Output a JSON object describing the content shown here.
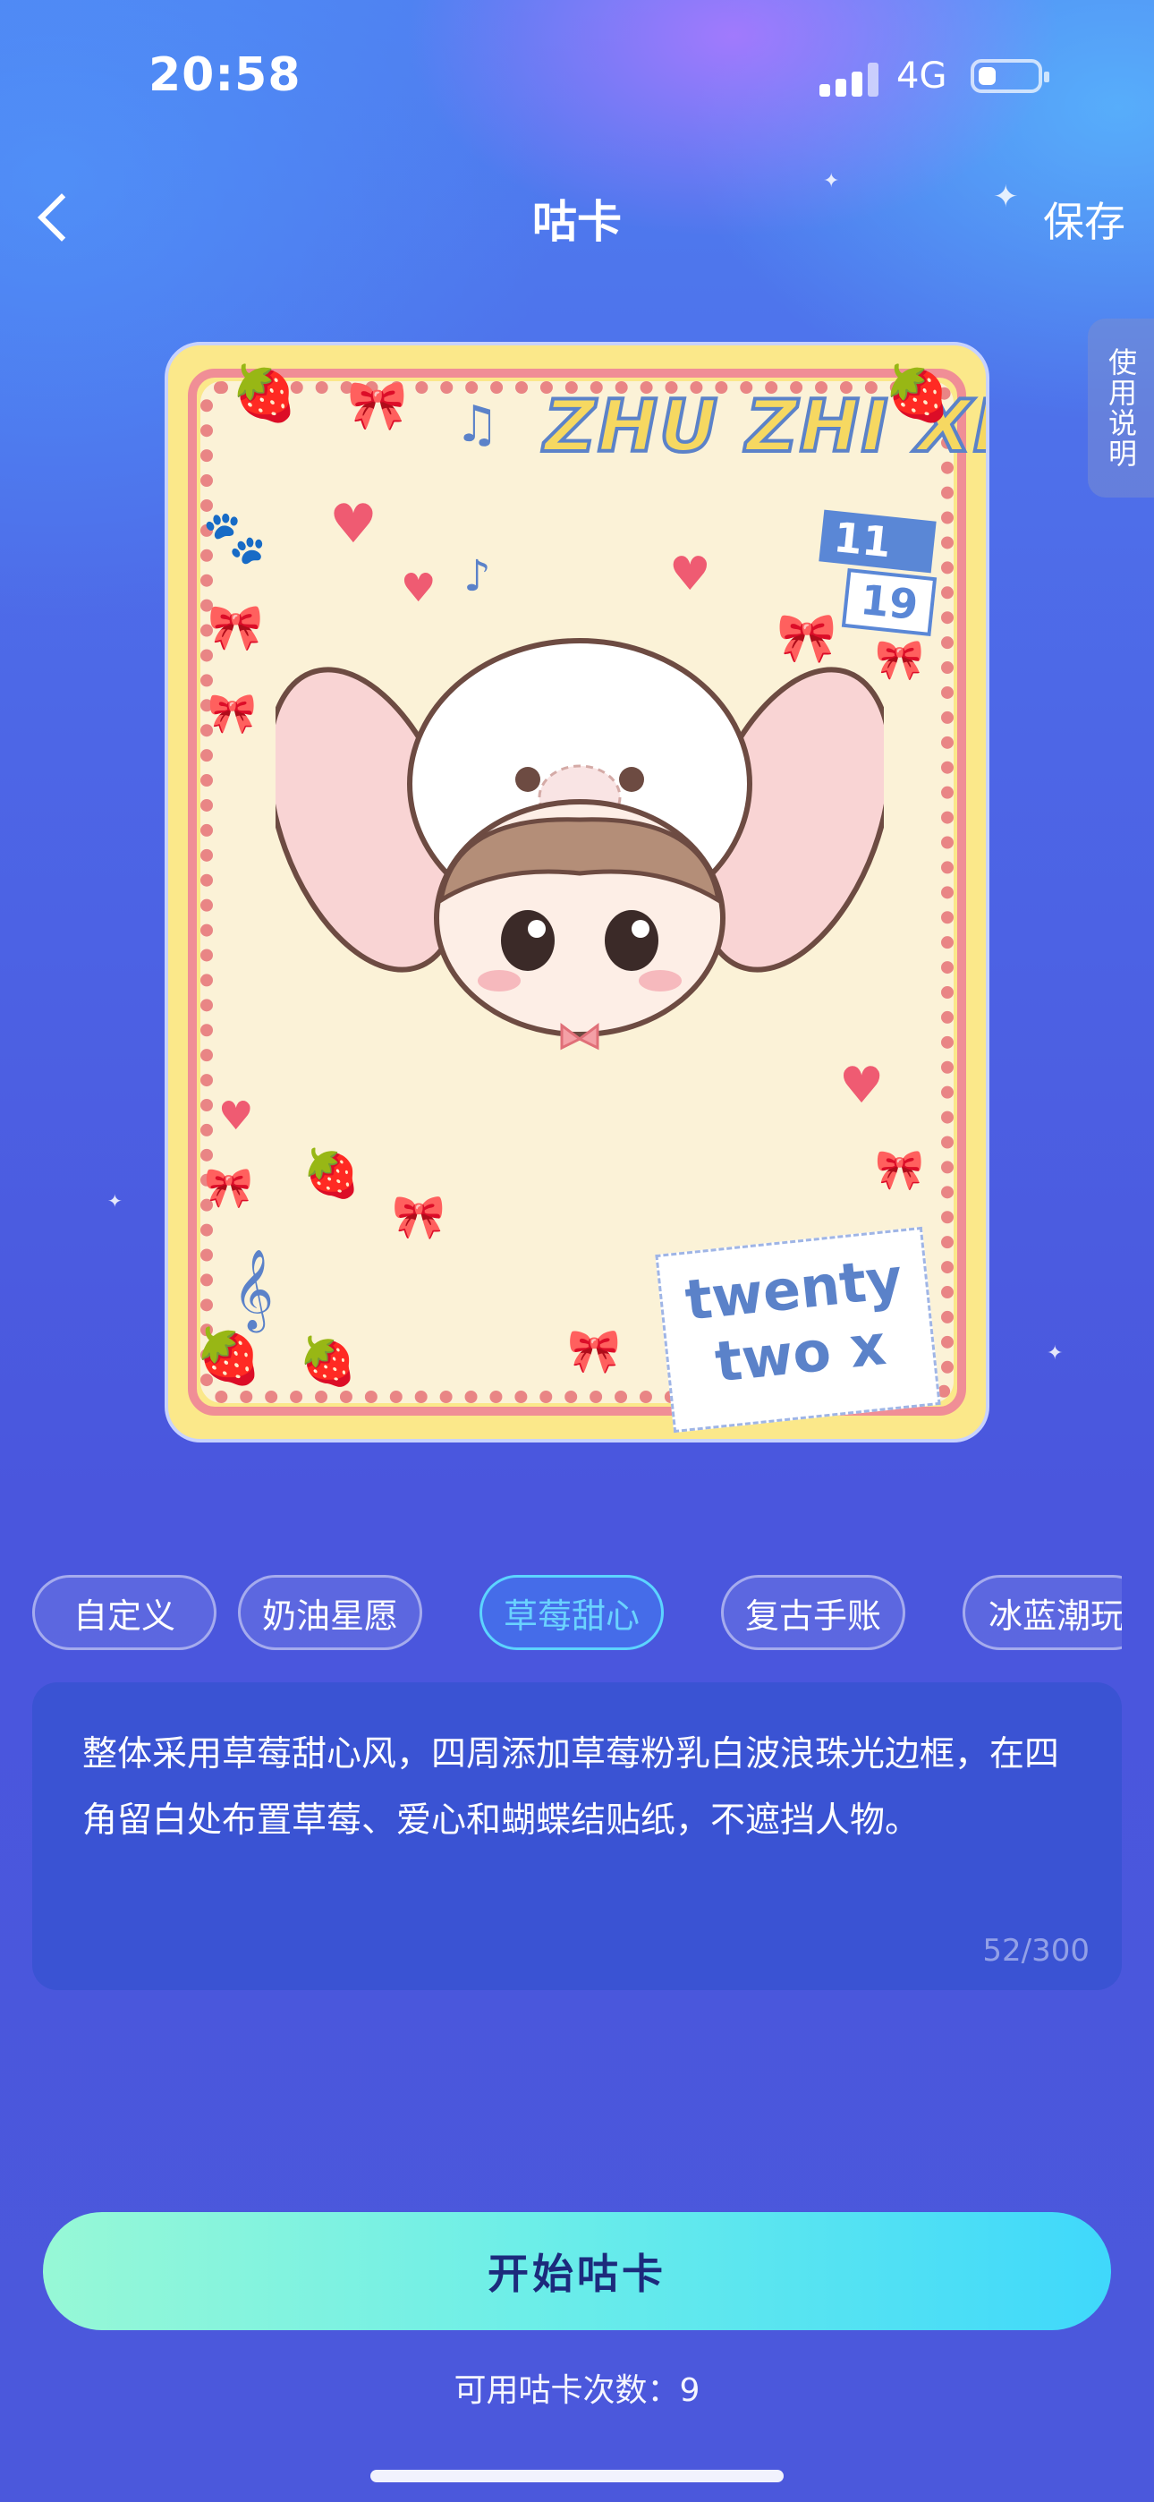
{
  "status_bar": {
    "time": "20:58",
    "network": "4G",
    "battery_level": 0.3
  },
  "nav": {
    "title": "咕卡",
    "save_label": "保存",
    "help_label": "使用说明"
  },
  "card": {
    "title": "ZHU ZHI XIN",
    "date_top": "11",
    "date_bottom": "19",
    "note_line1": "twenty",
    "note_line2": "two x"
  },
  "styles": {
    "items": [
      "自定义",
      "奶油星愿",
      "草莓甜心",
      "复古手账",
      "冰蓝潮玩"
    ],
    "selected": "草莓甜心"
  },
  "description": {
    "text": "整体采用草莓甜心风，四周添加草莓粉乳白波浪珠光边框，在四角留白处布置草莓、爱心和蝴蝶结贴纸，不遮挡人物。",
    "count": "52/300"
  },
  "cta": {
    "label": "开始咕卡",
    "remaining": "可用咕卡次数：9"
  },
  "colors": {
    "accent": "#5cd4ff",
    "cta_start": "#97f8d6",
    "cta_end": "#3fd8fb",
    "card_frame": "#f08e96"
  }
}
